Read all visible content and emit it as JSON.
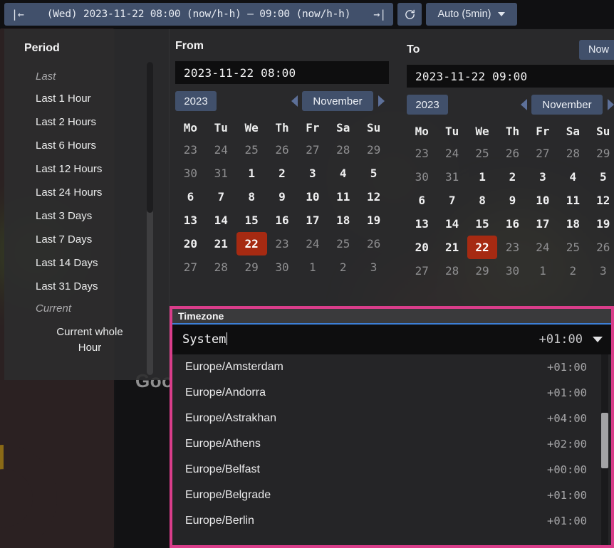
{
  "toolbar": {
    "prev_icon": "step-backward-icon",
    "next_icon": "step-forward-icon",
    "range_text": "(Wed) 2023-11-22 08:00 (now/h-h)  —  09:00 (now/h-h)",
    "prev_glyph": "|←",
    "next_glyph": "→|",
    "refresh_icon": "refresh-icon",
    "refresh_glyph": "⟳",
    "auto_label": "Auto (5min)"
  },
  "period": {
    "title": "Period",
    "groups": [
      {
        "label": "Last",
        "items": [
          "Last 1 Hour",
          "Last 2 Hours",
          "Last 6 Hours",
          "Last 12 Hours",
          "Last 24 Hours",
          "Last 3 Days",
          "Last 7 Days",
          "Last 14 Days",
          "Last 31 Days"
        ]
      },
      {
        "label": "Current",
        "items": [
          "Current whole Hour"
        ]
      }
    ]
  },
  "from": {
    "title": "From",
    "value": "2023-11-22 08:00",
    "year": "2023",
    "month": "November",
    "prev_month_icon": "chevron-left-icon",
    "next_month_icon": "chevron-right-icon",
    "dow": [
      "Mo",
      "Tu",
      "We",
      "Th",
      "Fr",
      "Sa",
      "Su"
    ],
    "weeks": [
      [
        {
          "d": "23",
          "state": "muted"
        },
        {
          "d": "24",
          "state": "muted"
        },
        {
          "d": "25",
          "state": "muted"
        },
        {
          "d": "26",
          "state": "muted"
        },
        {
          "d": "27",
          "state": "muted"
        },
        {
          "d": "28",
          "state": "muted"
        },
        {
          "d": "29",
          "state": "muted"
        }
      ],
      [
        {
          "d": "30",
          "state": "muted"
        },
        {
          "d": "31",
          "state": "muted"
        },
        {
          "d": "1",
          "state": "normal"
        },
        {
          "d": "2",
          "state": "normal"
        },
        {
          "d": "3",
          "state": "normal"
        },
        {
          "d": "4",
          "state": "normal"
        },
        {
          "d": "5",
          "state": "normal"
        }
      ],
      [
        {
          "d": "6",
          "state": "normal"
        },
        {
          "d": "7",
          "state": "normal"
        },
        {
          "d": "8",
          "state": "normal"
        },
        {
          "d": "9",
          "state": "normal"
        },
        {
          "d": "10",
          "state": "normal"
        },
        {
          "d": "11",
          "state": "normal"
        },
        {
          "d": "12",
          "state": "normal"
        }
      ],
      [
        {
          "d": "13",
          "state": "normal"
        },
        {
          "d": "14",
          "state": "normal"
        },
        {
          "d": "15",
          "state": "normal"
        },
        {
          "d": "16",
          "state": "normal"
        },
        {
          "d": "17",
          "state": "normal"
        },
        {
          "d": "18",
          "state": "normal"
        },
        {
          "d": "19",
          "state": "normal"
        }
      ],
      [
        {
          "d": "20",
          "state": "normal"
        },
        {
          "d": "21",
          "state": "normal"
        },
        {
          "d": "22",
          "state": "selected"
        },
        {
          "d": "23",
          "state": "muted"
        },
        {
          "d": "24",
          "state": "muted"
        },
        {
          "d": "25",
          "state": "muted"
        },
        {
          "d": "26",
          "state": "muted"
        }
      ],
      [
        {
          "d": "27",
          "state": "muted"
        },
        {
          "d": "28",
          "state": "muted"
        },
        {
          "d": "29",
          "state": "muted"
        },
        {
          "d": "30",
          "state": "muted"
        },
        {
          "d": "1",
          "state": "muted"
        },
        {
          "d": "2",
          "state": "muted"
        },
        {
          "d": "3",
          "state": "muted"
        }
      ]
    ]
  },
  "to": {
    "title": "To",
    "now_label": "Now",
    "value": "2023-11-22 09:00",
    "year": "2023",
    "month": "November",
    "prev_month_icon": "chevron-left-icon",
    "next_month_icon": "chevron-right-icon",
    "dow": [
      "Mo",
      "Tu",
      "We",
      "Th",
      "Fr",
      "Sa",
      "Su"
    ],
    "weeks": [
      [
        {
          "d": "23",
          "state": "muted"
        },
        {
          "d": "24",
          "state": "muted"
        },
        {
          "d": "25",
          "state": "muted"
        },
        {
          "d": "26",
          "state": "muted"
        },
        {
          "d": "27",
          "state": "muted"
        },
        {
          "d": "28",
          "state": "muted"
        },
        {
          "d": "29",
          "state": "muted"
        }
      ],
      [
        {
          "d": "30",
          "state": "muted"
        },
        {
          "d": "31",
          "state": "muted"
        },
        {
          "d": "1",
          "state": "normal"
        },
        {
          "d": "2",
          "state": "normal"
        },
        {
          "d": "3",
          "state": "normal"
        },
        {
          "d": "4",
          "state": "normal"
        },
        {
          "d": "5",
          "state": "normal"
        }
      ],
      [
        {
          "d": "6",
          "state": "normal"
        },
        {
          "d": "7",
          "state": "normal"
        },
        {
          "d": "8",
          "state": "normal"
        },
        {
          "d": "9",
          "state": "normal"
        },
        {
          "d": "10",
          "state": "normal"
        },
        {
          "d": "11",
          "state": "normal"
        },
        {
          "d": "12",
          "state": "normal"
        }
      ],
      [
        {
          "d": "13",
          "state": "normal"
        },
        {
          "d": "14",
          "state": "normal"
        },
        {
          "d": "15",
          "state": "normal"
        },
        {
          "d": "16",
          "state": "normal"
        },
        {
          "d": "17",
          "state": "normal"
        },
        {
          "d": "18",
          "state": "normal"
        },
        {
          "d": "19",
          "state": "normal"
        }
      ],
      [
        {
          "d": "20",
          "state": "normal"
        },
        {
          "d": "21",
          "state": "normal"
        },
        {
          "d": "22",
          "state": "selected"
        },
        {
          "d": "23",
          "state": "muted"
        },
        {
          "d": "24",
          "state": "muted"
        },
        {
          "d": "25",
          "state": "muted"
        },
        {
          "d": "26",
          "state": "muted"
        }
      ],
      [
        {
          "d": "27",
          "state": "muted"
        },
        {
          "d": "28",
          "state": "muted"
        },
        {
          "d": "29",
          "state": "muted"
        },
        {
          "d": "30",
          "state": "muted"
        },
        {
          "d": "1",
          "state": "muted"
        },
        {
          "d": "2",
          "state": "muted"
        },
        {
          "d": "3",
          "state": "muted"
        }
      ]
    ]
  },
  "timezone": {
    "label": "Timezone",
    "input_value": "System",
    "selected_offset": "+01:00",
    "dropdown_icon": "chevron-down-icon",
    "options": [
      {
        "name": "Europe/Amsterdam",
        "offset": "+01:00"
      },
      {
        "name": "Europe/Andorra",
        "offset": "+01:00"
      },
      {
        "name": "Europe/Astrakhan",
        "offset": "+04:00"
      },
      {
        "name": "Europe/Athens",
        "offset": "+02:00"
      },
      {
        "name": "Europe/Belfast",
        "offset": "+00:00"
      },
      {
        "name": "Europe/Belgrade",
        "offset": "+01:00"
      },
      {
        "name": "Europe/Berlin",
        "offset": "+01:00"
      }
    ]
  },
  "background": {
    "attribution": "Goog"
  },
  "colors": {
    "accent_blue": "#41506b",
    "selected_day": "#a62a12",
    "highlight_border": "#d93d8a",
    "focus_border": "#3d7fd6",
    "panel_bg": "#2c2c2e"
  }
}
